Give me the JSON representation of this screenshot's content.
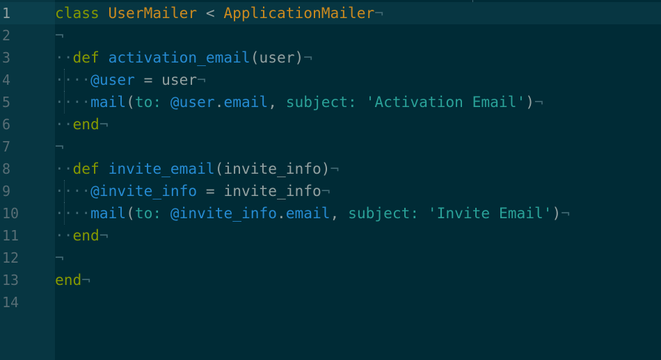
{
  "editor": {
    "line_numbers": [
      "1",
      "2",
      "3",
      "4",
      "5",
      "6",
      "7",
      "8",
      "9",
      "10",
      "11",
      "12",
      "13",
      "14"
    ],
    "current_line": 1,
    "invisible_space": "·",
    "invisible_newline": "¬",
    "colors": {
      "background": "#002b36",
      "gutter": "#073642",
      "keyword": "#859900",
      "class_name": "#cb8a1f",
      "method": "#268bd2",
      "string": "#2aa198"
    },
    "code": {
      "line1": {
        "kw": "class",
        "cls1": "UserMailer",
        "op": "<",
        "cls2": "ApplicationMailer"
      },
      "line3": {
        "kw": "def",
        "fn": "activation_email",
        "paren_open": "(",
        "param": "user",
        "paren_close": ")"
      },
      "line4": {
        "ivar": "@user",
        "op": "=",
        "val": "user"
      },
      "line5": {
        "fn": "mail",
        "paren_open": "(",
        "sym1": "to:",
        "ivar": "@user",
        "dot": ".",
        "method": "email",
        "comma": ",",
        "sym2": "subject:",
        "str": "'Activation Email'",
        "paren_close": ")"
      },
      "line6": {
        "kw": "end"
      },
      "line8": {
        "kw": "def",
        "fn": "invite_email",
        "paren_open": "(",
        "param": "invite_info",
        "paren_close": ")"
      },
      "line9": {
        "ivar": "@invite_info",
        "op": "=",
        "val": "invite_info"
      },
      "line10": {
        "fn": "mail",
        "paren_open": "(",
        "sym1": "to:",
        "ivar": "@invite_info",
        "dot": ".",
        "method": "email",
        "comma": ",",
        "sym2": "subject:",
        "str": "'Invite Email'",
        "paren_close": ")"
      },
      "line11": {
        "kw": "end"
      },
      "line13": {
        "kw": "end"
      }
    }
  }
}
